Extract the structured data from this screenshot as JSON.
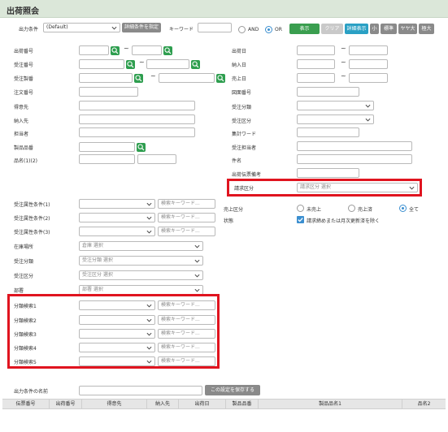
{
  "header": {
    "title": "出荷照会"
  },
  "top": {
    "output_label": "出力条件",
    "output_value": "(Default)",
    "detail_button": "詳細条件を指定",
    "keyword_label": "キーワード",
    "keyword_value": "",
    "and_label": "AND",
    "or_label": "OR",
    "and_or_selected": "OR",
    "buttons": {
      "show": "表示",
      "clear": "クリア",
      "detail_show": "詳細表示",
      "small": "小",
      "standard": "標準",
      "slightly_large": "ヤヤ大",
      "large": "極大"
    }
  },
  "left_fields": {
    "shipment_no": "出荷番号",
    "order_no": "受注番号",
    "order_item_no": "受注製番",
    "note_no": "注文番号",
    "customer": "得意先",
    "ship_to": "納入先",
    "contact": "担当者",
    "product_code": "製品品番",
    "product_name": "品名(1)(2)"
  },
  "right_fields": {
    "ship_date": "出荷日",
    "delivery_date": "納入日",
    "sales_date": "売上日",
    "drawing_no": "図面番号",
    "order_class": "受注分類",
    "order_div": "受注区分",
    "collect_word": "集計ワード",
    "order_staff": "受注担当者",
    "subject": "件名",
    "slip_note": "出荷伝票備考",
    "invoice_div": "請求区分",
    "invoice_placeholder": "請求区分 選択"
  },
  "attr_fields": {
    "attr1": "受注属性条件(1)",
    "attr2": "受注属性条件(2)",
    "attr3": "受注属性条件(3)",
    "search_placeholder": "検索キーワード...",
    "location": "在庫場所",
    "location_placeholder": "倉庫 選択",
    "class": "受注分類",
    "class_placeholder": "受注分類 選択",
    "div": "受注区分",
    "div_placeholder": "受注区分 選択",
    "dept": "部署",
    "dept_placeholder": "部署 選択"
  },
  "sales_div": {
    "label": "売上区分",
    "not_sold": "未売上",
    "sold": "売上済",
    "all": "全て",
    "selected": "全て"
  },
  "state": {
    "label": "状態",
    "checkbox_text": "請求締めまたは月次更新済を除く",
    "checked": true
  },
  "category_search": {
    "c1": "分類検索1",
    "c2": "分類検索2",
    "c3": "分類検索3",
    "c4": "分類検索4",
    "c5": "分類検索5",
    "placeholder": "検索キーワード..."
  },
  "save_row": {
    "label": "出力条件の名前",
    "value": "",
    "button": "この設定を保存する"
  },
  "table": {
    "columns": [
      "伝票番号",
      "出荷番号",
      "得意先",
      "納入先",
      "出荷日",
      "製品品番",
      "製品品名1",
      "品名2"
    ]
  },
  "colors": {
    "header_bg": "#dbe7d9",
    "accent_green": "#3a9e4f",
    "accent_teal": "#2aa0c4",
    "highlight_red": "#e0141f",
    "radio_blue": "#3b8fd0"
  }
}
